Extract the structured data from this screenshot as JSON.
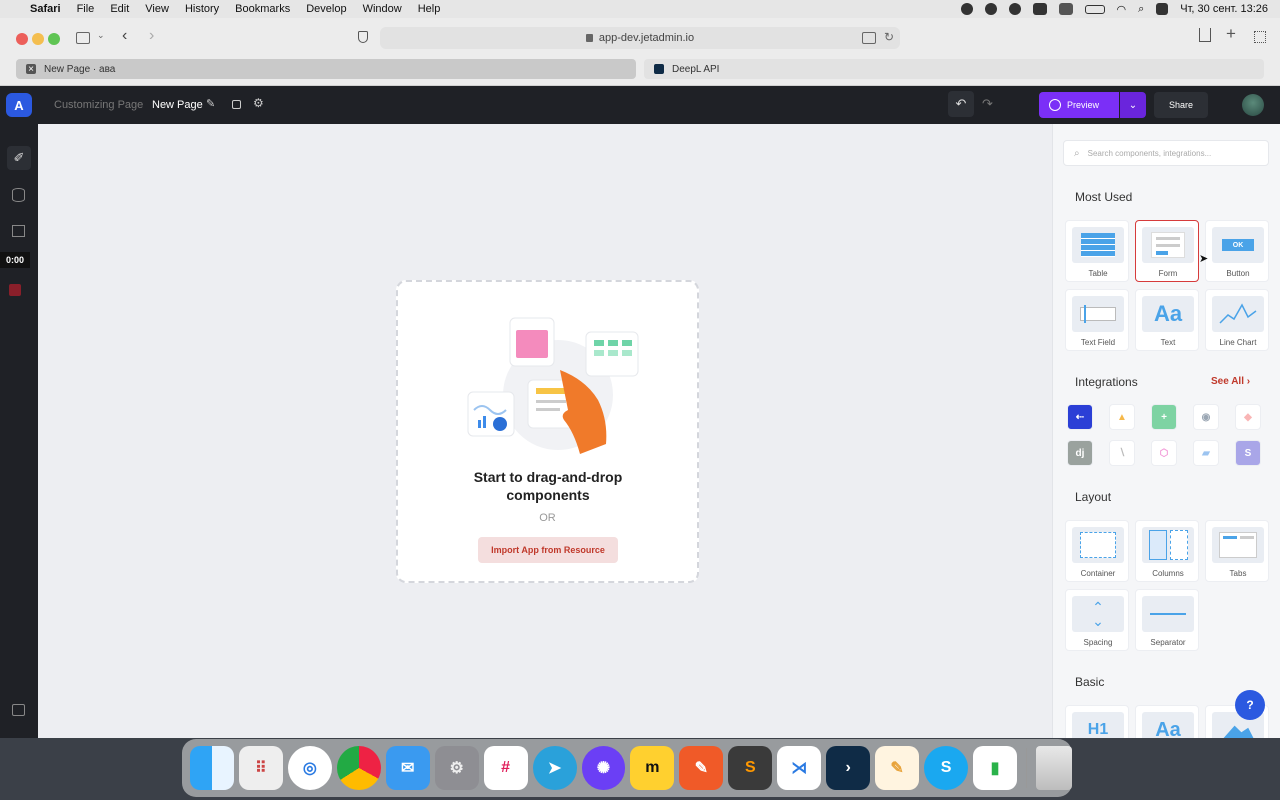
{
  "menubar": {
    "items": [
      "Safari",
      "File",
      "Edit",
      "View",
      "History",
      "Bookmarks",
      "Develop",
      "Window",
      "Help"
    ],
    "datetime": "Чт, 30 сент.  13:26"
  },
  "browser": {
    "url": "app-dev.jetadmin.io",
    "tabs": [
      {
        "label": "New Page · ава",
        "active": true
      },
      {
        "label": "DeepL API",
        "active": false
      }
    ]
  },
  "app": {
    "logo": "A",
    "breadcrumb": "Customizing Page",
    "page_name": "New Page",
    "preview_label": "Preview",
    "share_label": "Share",
    "timer": "0:00"
  },
  "canvas": {
    "headline": "Start to drag-and-drop components",
    "or": "OR",
    "import_label": "Import App from Resource"
  },
  "panel": {
    "search_placeholder": "Search components, integrations...",
    "most_used_title": "Most Used",
    "most_used": [
      "Table",
      "Form",
      "Button",
      "Text Field",
      "Text",
      "Line Chart"
    ],
    "integrations_title": "Integrations",
    "see_all": "See All",
    "integrations": [
      "jetadmin-icon",
      "firebase-icon",
      "sheets-icon",
      "postgres-icon",
      "airtable-icon",
      "django-icon",
      "supabase-icon",
      "graphql-icon",
      "stripe-icon",
      "s-icon"
    ],
    "layout_title": "Layout",
    "layout": [
      "Container",
      "Columns",
      "Tabs",
      "Spacing",
      "Separator"
    ],
    "basic_title": "Basic",
    "basic": [
      "H1",
      "Aa"
    ],
    "button_ok": "OK",
    "text_aa": "Aa",
    "help": "?"
  },
  "colors": {
    "accent": "#7b2ff7",
    "brand": "#2b59e0",
    "danger": "#d63b3b"
  }
}
